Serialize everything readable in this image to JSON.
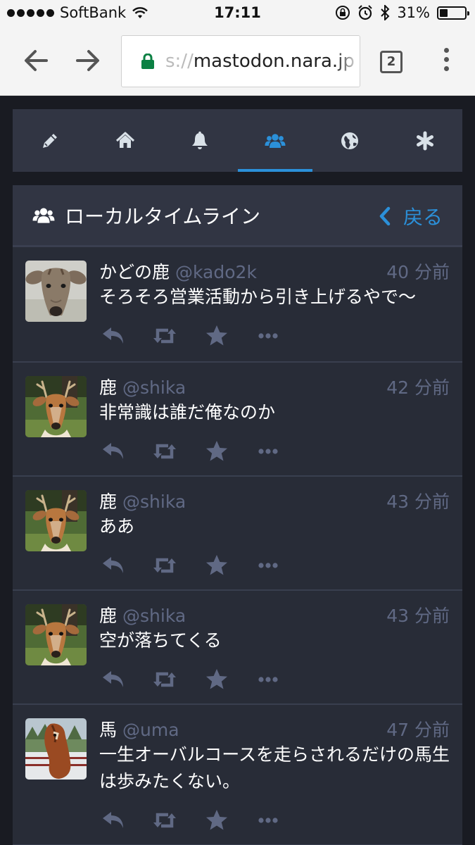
{
  "statusbar": {
    "carrier": "SoftBank",
    "time": "17:11",
    "battery": "31%",
    "battery_level": 0.31
  },
  "browser": {
    "url_prefix": "s://",
    "url_host": "mastodon.nara.jp",
    "tab_count": "2"
  },
  "tabs": [
    {
      "icon": "pencil-icon"
    },
    {
      "icon": "home-icon"
    },
    {
      "icon": "bell-icon"
    },
    {
      "icon": "users-icon",
      "active": true
    },
    {
      "icon": "globe-icon"
    },
    {
      "icon": "asterisk-icon"
    }
  ],
  "column": {
    "title": "ローカルタイムライン",
    "back_label": "戻る"
  },
  "statuses": [
    {
      "name": "かどの鹿",
      "acct": "@kado2k",
      "time": "40 分前",
      "text": "そろそろ営業活動から引き上げるやで〜",
      "avatar": "deer-face-avatar"
    },
    {
      "name": "鹿",
      "acct": "@shika",
      "time": "42 分前",
      "text": "非常識は誰だ俺なのか",
      "avatar": "antlered-deer-avatar"
    },
    {
      "name": "鹿",
      "acct": "@shika",
      "time": "43 分前",
      "text": "ああ",
      "avatar": "antlered-deer-avatar"
    },
    {
      "name": "鹿",
      "acct": "@shika",
      "time": "43 分前",
      "text": "空が落ちてくる",
      "avatar": "antlered-deer-avatar"
    },
    {
      "name": "馬",
      "acct": "@uma",
      "time": "47 分前",
      "text": "一生オーバルコースを走らされるだけの馬生は歩みたくない。",
      "avatar": "horse-avatar"
    }
  ],
  "colors": {
    "accent": "#2b90d9",
    "background": "#191b22",
    "column": "#282c37",
    "muted": "#606984"
  }
}
